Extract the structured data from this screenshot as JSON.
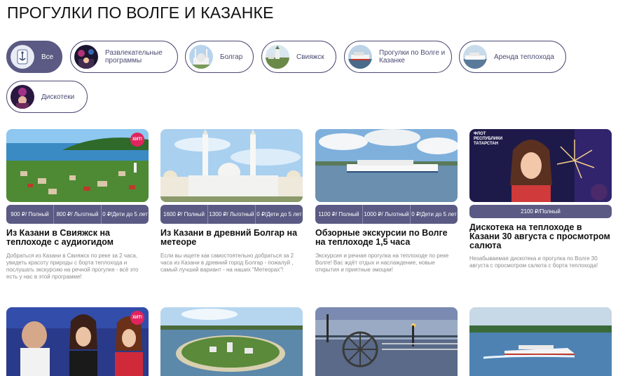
{
  "page": {
    "title": "ПРОГУЛКИ ПО ВОЛГЕ И КАЗАНКЕ"
  },
  "filters": [
    {
      "label": "Все",
      "icon": "anchor-logo-icon",
      "active": true
    },
    {
      "label": "Развлекательные программы",
      "icon": "party-photo-icon",
      "active": false
    },
    {
      "label": "Болгар",
      "icon": "mosque-photo-icon",
      "active": false
    },
    {
      "label": "Свияжск",
      "icon": "island-photo-icon",
      "active": false
    },
    {
      "label": "Прогулки по Волге и Казанке",
      "icon": "ship-photo-icon",
      "active": false
    },
    {
      "label": "Аренда теплохода",
      "icon": "boat-photo-icon",
      "active": false
    },
    {
      "label": "Дискотеки",
      "icon": "disco-photo-icon",
      "active": false
    }
  ],
  "cards": [
    {
      "title": "Из Казани в Свияжск на теплоходе с аудиогидом",
      "badge": "ХИТ!",
      "prices": [
        "900 ₽/ Полный",
        "800 ₽/ Льготный",
        "0 ₽/Дети до 5 лет"
      ],
      "desc": "Добраться из Казани в Свияжск по реке за 2 часа, увидеть красоту природы с борта теплохода и послушать экскурсию на речной прогулке - всё это есть у нас в этой программе!"
    },
    {
      "title": "Из Казани в древний Болгар на метеоре",
      "badge": "",
      "prices": [
        "1600 ₽/ Полный",
        "1300 ₽/ Льготный",
        "0 ₽/Дети до 5 лет"
      ],
      "desc": "Если вы ищете как самостоятельно добраться за 2 часа из Казани в древний город Болгар - пожалуй , самый лучший вариант - на наших \"Метеорах\"!"
    },
    {
      "title": "Обзорные экскурсии по Волге на теплоходе 1,5 часа",
      "badge": "",
      "prices": [
        "1100 ₽/ Полный",
        "1000 ₽/ Льготный",
        "0 ₽/Дети до 5 лет"
      ],
      "desc": "Экскурсия и речная прогулка на теплоходе по реке Волге! Вас ждёт отдых и наслаждение, новые открытия и приятные эмоции!"
    },
    {
      "title": "Дискотека на теплоходе в Казани 30 августа с просмотром салюта",
      "badge": "",
      "logo": "ФЛОТ РЕСПУБЛИКИ ТАТАРСТАН",
      "prices": [
        "2100 ₽/Полный"
      ],
      "desc": "Незабываемая дискотека и прогулка по Волге 30 августа с просмотром салюта с борта теплохода!"
    }
  ],
  "cards_row2": [
    {
      "badge": "ХИТ!",
      "icon": "karaoke-photo"
    },
    {
      "badge": "",
      "icon": "island-aerial-photo"
    },
    {
      "badge": "",
      "icon": "ship-deck-photo"
    },
    {
      "badge": "",
      "icon": "hydrofoil-photo"
    }
  ],
  "colors": {
    "accent": "#5a5a84",
    "badge": "#e0245e"
  }
}
